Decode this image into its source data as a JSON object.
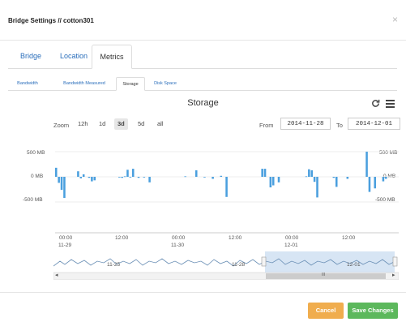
{
  "modal": {
    "title": "Bridge Settings // cotton301",
    "close": "×"
  },
  "tabs": [
    {
      "label": "Bridge",
      "active": false
    },
    {
      "label": "Location",
      "active": false
    },
    {
      "label": "Metrics",
      "active": true
    }
  ],
  "subtabs": [
    {
      "label": "Bandwidth",
      "active": false
    },
    {
      "label": "Bandwidth Measured",
      "active": false
    },
    {
      "label": "Storage",
      "active": true
    },
    {
      "label": "Disk Space",
      "active": false
    }
  ],
  "chart_toolbar": {
    "zoom_label": "Zoom",
    "zoom_options": [
      "12h",
      "1d",
      "3d",
      "5d",
      "all"
    ],
    "zoom_selected": "3d",
    "from_label": "From",
    "from_value": "2014-11-28",
    "to_label": "To",
    "to_value": "2014-12-01",
    "refresh_icon": "refresh-icon",
    "menu_icon": "menu-icon"
  },
  "navigator": {
    "labels": [
      "11-25",
      "11-28",
      "12-01"
    ],
    "left_arrow": "◂",
    "right_arrow": "▸",
    "scroll_grip": "III"
  },
  "footer": {
    "cancel_label": "Cancel",
    "save_label": "Save Changes"
  },
  "colors": {
    "bar": "#4a9fde",
    "cancel": "#f0ad4e",
    "save": "#5cb85c",
    "link": "#2a6ebb",
    "navigator_fill": "#c9dcf0"
  },
  "chart_data": {
    "type": "bar",
    "title": "Storage",
    "ylim": [
      -600,
      600
    ],
    "y_ticks": [
      "500 MB",
      "0 MB",
      "-500 MB"
    ],
    "y_ticks_right": [
      "500 MB",
      "0 MB",
      "-500 MB"
    ],
    "x_ticks": [
      {
        "time": "00:00",
        "date": "11-29"
      },
      {
        "time": "12:00",
        "date": ""
      },
      {
        "time": "00:00",
        "date": "11-30"
      },
      {
        "time": "12:00",
        "date": ""
      },
      {
        "time": "00:00",
        "date": "12-01"
      },
      {
        "time": "12:00",
        "date": ""
      }
    ],
    "values": [
      180,
      -120,
      -260,
      -420,
      0,
      0,
      0,
      0,
      110,
      -30,
      50,
      0,
      -20,
      -90,
      -70,
      0,
      0,
      0,
      0,
      0,
      0,
      0,
      0,
      -10,
      -20,
      10,
      140,
      -10,
      160,
      0,
      -20,
      0,
      -10,
      0,
      -110,
      0,
      0,
      0,
      0,
      0,
      0,
      0,
      0,
      0,
      0,
      0,
      0,
      10,
      0,
      0,
      0,
      130,
      0,
      0,
      -10,
      0,
      0,
      -40,
      0,
      0,
      20,
      0,
      -400,
      0,
      0,
      0,
      0,
      0,
      0,
      0,
      0,
      0,
      0,
      0,
      0,
      160,
      160,
      0,
      -210,
      -170,
      0,
      -110,
      0,
      0,
      0,
      0,
      0,
      0,
      0,
      0,
      0,
      10,
      150,
      130,
      -100,
      -410,
      0,
      0,
      0,
      0,
      0,
      -20,
      -200,
      0,
      0,
      0,
      -40,
      0,
      0,
      0,
      0,
      0,
      0,
      500,
      -300,
      0,
      -230,
      0,
      0,
      -90,
      -40,
      0,
      0,
      0,
      0
    ]
  }
}
